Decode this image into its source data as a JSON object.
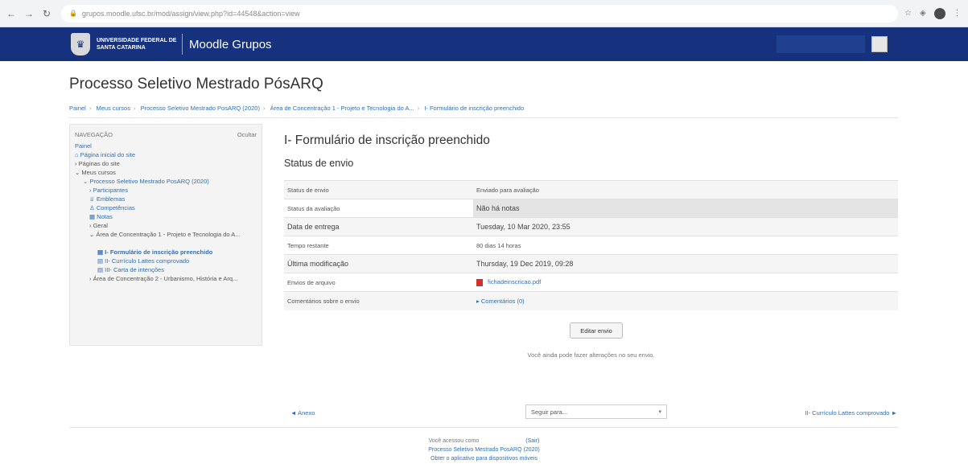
{
  "browser": {
    "url": "grupos.moodle.ufsc.br/mod/assign/view.php?id=44548&action=view"
  },
  "navbar": {
    "logo_text": "UNIVERSIDADE FEDERAL DE SANTA CATARINA",
    "site_name": "Moodle Grupos"
  },
  "page": {
    "title": "Processo Seletivo Mestrado PósARQ",
    "breadcrumb": [
      "Painel",
      "Meus cursos",
      "Processo Seletivo Mestrado PosARQ (2020)",
      "Área de Concentração 1 - Projeto e Tecnologia do A...",
      "I- Formulário de inscrição preenchido"
    ]
  },
  "navigation": {
    "heading": "NAVEGAÇÃO",
    "hide": "Ocultar",
    "items": [
      "Painel",
      "Página inicial do site",
      "Páginas do site",
      "Meus cursos",
      "Processo Seletivo Mestrado PosARQ (2020)",
      "Participantes",
      "Emblemas",
      "Competências",
      "Notas",
      "Geral",
      "Área de Concentração 1 - Projeto e Tecnologia do A...",
      "I- Formulário de inscrição preenchido",
      "II- Currículo Lattes comprovado",
      "III- Carta de intenções",
      "Área de Concentração 2 - Urbanismo, História e Arq..."
    ]
  },
  "main": {
    "heading": "I- Formulário de inscrição preenchido",
    "subheading": "Status de envio",
    "rows": [
      {
        "label": "Status de envio",
        "value": "Enviado para avaliação"
      },
      {
        "label": "Status da avaliação",
        "value": "Não há notas"
      },
      {
        "label": "Data de entrega",
        "value": "Tuesday, 10 Mar 2020, 23:55"
      },
      {
        "label": "Tempo restante",
        "value": "80 dias 14 horas"
      },
      {
        "label": "Última modificação",
        "value": "Thursday, 19 Dec 2019, 09:28"
      },
      {
        "label": "Envios de arquivo",
        "value": "fichadeinscricao.pdf"
      },
      {
        "label": "Comentários sobre o envio",
        "value": "Comentários (0)"
      }
    ],
    "edit_button": "Editar envio",
    "info_text": "Você ainda pode fazer alterações no seu envio."
  },
  "activity_nav": {
    "prev": "◄ Anexo",
    "jump": "Seguir para...",
    "next": "II- Currículo Lattes comprovado ►"
  },
  "footer": {
    "logged_in": "Você acessou como",
    "logout": "(Sair)",
    "course": "Processo Seletivo Mestrado PosARQ (2020)",
    "app_link": "Obter o aplicativo para dispositivos móveis"
  }
}
